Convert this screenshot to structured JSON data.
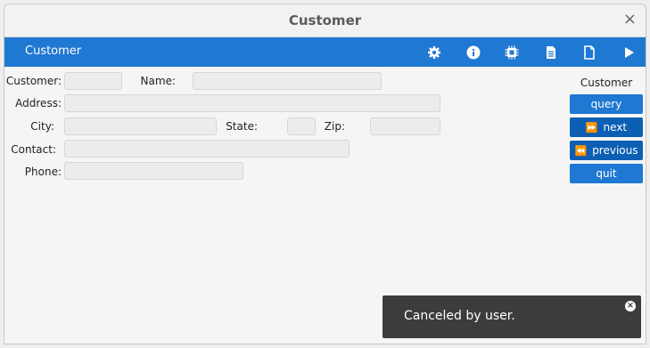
{
  "window": {
    "title": "Customer",
    "close_glyph": "×"
  },
  "toolbar": {
    "title": "Customer",
    "icons": [
      "gear-icon",
      "info-icon",
      "chip-icon",
      "document-icon",
      "blank-document-icon",
      "play-icon"
    ]
  },
  "form": {
    "customer_label": "Customer:",
    "name_label": "Name:",
    "address_label": "Address:",
    "city_label": "City:",
    "state_label": "State:",
    "zip_label": "Zip:",
    "contact_label": "Contact:",
    "phone_label": "Phone:",
    "customer_value": "",
    "name_value": "",
    "address_value": "",
    "city_value": "",
    "state_value": "",
    "zip_value": "",
    "contact_value": "",
    "phone_value": ""
  },
  "panel": {
    "title": "Customer",
    "query_label": "query",
    "next_label": "next",
    "previous_label": "previous",
    "quit_label": "quit"
  },
  "toast": {
    "message": "Canceled by user."
  },
  "colors": {
    "accent": "#1f78d1",
    "accent_dark": "#0d5fb3",
    "toast_bg": "#3c3c3c"
  }
}
